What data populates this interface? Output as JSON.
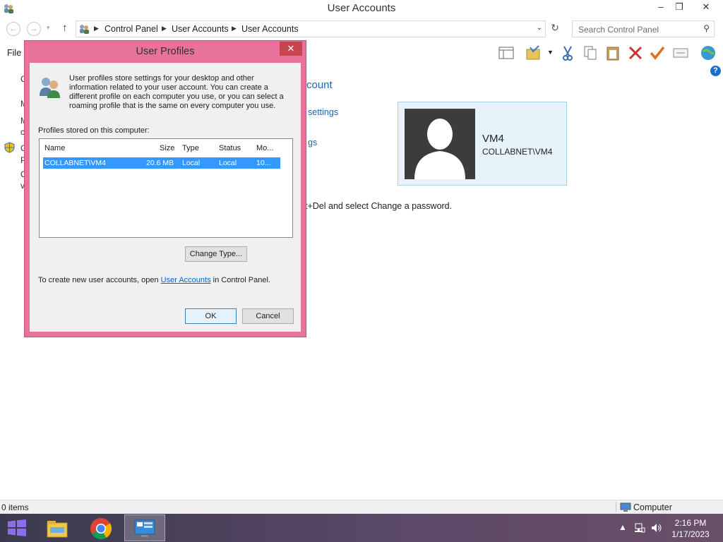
{
  "window": {
    "title": "User Accounts",
    "minimize": "–",
    "restore": "❐",
    "close": "✕"
  },
  "nav": {
    "breadcrumbs": [
      "Control Panel",
      "User Accounts",
      "User Accounts"
    ],
    "search_placeholder": "Search Control Panel"
  },
  "menu": {
    "file": "File"
  },
  "background": {
    "heading_fragment": "count",
    "link_settings": "settings",
    "link_gs": "gs",
    "text_fragment": "t+Del and select Change a password.",
    "clipped_letters": [
      "C",
      "M",
      "M",
      "c",
      "C",
      "P",
      "C",
      "v"
    ]
  },
  "account": {
    "name": "VM4",
    "domain": "COLLABNET\\VM4"
  },
  "dialog": {
    "title": "User Profiles",
    "intro": "User profiles store settings for your desktop and other information related to your user account. You can create a different profile on each computer you use, or you can select a roaming profile that is the same on every computer you use.",
    "profiles_label": "Profiles stored on this computer:",
    "columns": [
      "Name",
      "Size",
      "Type",
      "Status",
      "Mo..."
    ],
    "rows": [
      {
        "name": "COLLABNET\\VM4",
        "size": "20.6 MB",
        "type": "Local",
        "status": "Local",
        "modified": "10..."
      }
    ],
    "change_type": "Change Type...",
    "footer_before": "To create new user accounts, open ",
    "footer_link": "User Accounts",
    "footer_after": " in Control Panel.",
    "ok": "OK",
    "cancel": "Cancel"
  },
  "status": {
    "items": "0 items",
    "location": "Computer"
  },
  "taskbar": {
    "time": "2:16 PM",
    "date": "1/17/2023"
  },
  "colors": {
    "dialog_frame": "#e9729d",
    "selection": "#3399ff",
    "link": "#1e64b4",
    "close_button": "#c5464f"
  }
}
